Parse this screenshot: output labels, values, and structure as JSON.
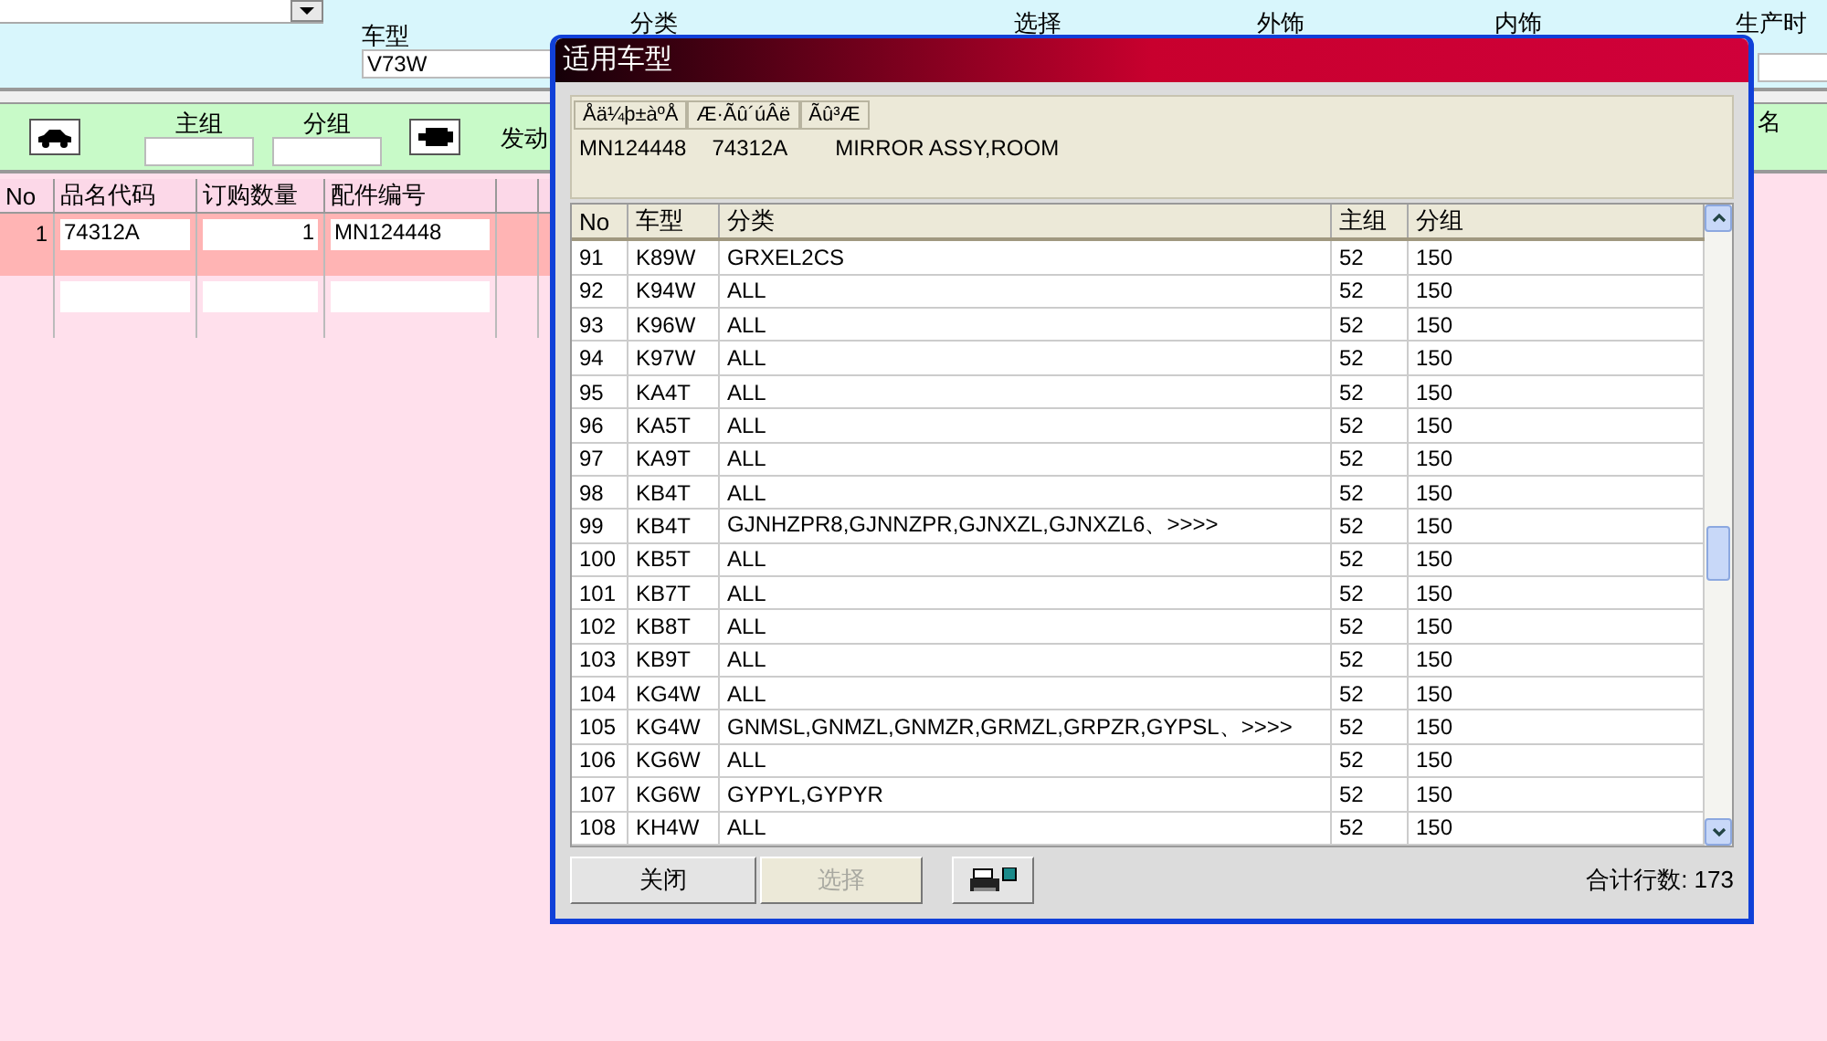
{
  "filter_bar": {
    "model_label": "车型",
    "model_value": "V73W",
    "labels": [
      "分类",
      "选择",
      "外饰",
      "内饰",
      "生产时"
    ]
  },
  "group_bar": {
    "main_group_label": "主组",
    "sub_group_label": "分组",
    "engine_label": "发动",
    "name_label": "名"
  },
  "order_table": {
    "columns": [
      "No",
      "品名代码",
      "订购数量",
      "配件编号"
    ],
    "rows": [
      {
        "no": "1",
        "code": "74312A",
        "qty": "1",
        "part": "MN124448",
        "selected": true
      },
      {
        "no": "",
        "code": "",
        "qty": "",
        "part": "",
        "selected": false
      }
    ]
  },
  "dialog": {
    "title": "适用车型",
    "info_headers": [
      "Åä¼þ±àºÅ",
      "Æ·Ãû´úÂë",
      "Ãû³Æ"
    ],
    "info_values": [
      "MN124448",
      "74312A",
      "MIRROR ASSY,ROOM"
    ],
    "columns": [
      "No",
      "车型",
      "分类",
      "主组",
      "分组"
    ],
    "rows": [
      [
        "91",
        "K89W",
        "GRXEL2CS",
        "52",
        "150"
      ],
      [
        "92",
        "K94W",
        "ALL",
        "52",
        "150"
      ],
      [
        "93",
        "K96W",
        "ALL",
        "52",
        "150"
      ],
      [
        "94",
        "K97W",
        "ALL",
        "52",
        "150"
      ],
      [
        "95",
        "KA4T",
        "ALL",
        "52",
        "150"
      ],
      [
        "96",
        "KA5T",
        "ALL",
        "52",
        "150"
      ],
      [
        "97",
        "KA9T",
        "ALL",
        "52",
        "150"
      ],
      [
        "98",
        "KB4T",
        "ALL",
        "52",
        "150"
      ],
      [
        "99",
        "KB4T",
        "GJNHZPR8,GJNNZPR,GJNXZL,GJNXZL6、>>>>",
        "52",
        "150"
      ],
      [
        "100",
        "KB5T",
        "ALL",
        "52",
        "150"
      ],
      [
        "101",
        "KB7T",
        "ALL",
        "52",
        "150"
      ],
      [
        "102",
        "KB8T",
        "ALL",
        "52",
        "150"
      ],
      [
        "103",
        "KB9T",
        "ALL",
        "52",
        "150"
      ],
      [
        "104",
        "KG4W",
        "ALL",
        "52",
        "150"
      ],
      [
        "105",
        "KG4W",
        "GNMSL,GNMZL,GNMZR,GRMZL,GRPZR,GYPSL、>>>>",
        "52",
        "150"
      ],
      [
        "106",
        "KG6W",
        "ALL",
        "52",
        "150"
      ],
      [
        "107",
        "KG6W",
        "GYPYL,GYPYR",
        "52",
        "150"
      ],
      [
        "108",
        "KH4W",
        "ALL",
        "52",
        "150"
      ]
    ],
    "buttons": [
      {
        "label": "关闭",
        "disabled": false
      },
      {
        "label": "选择",
        "disabled": true
      }
    ],
    "total_label": "合计行数: 173"
  }
}
